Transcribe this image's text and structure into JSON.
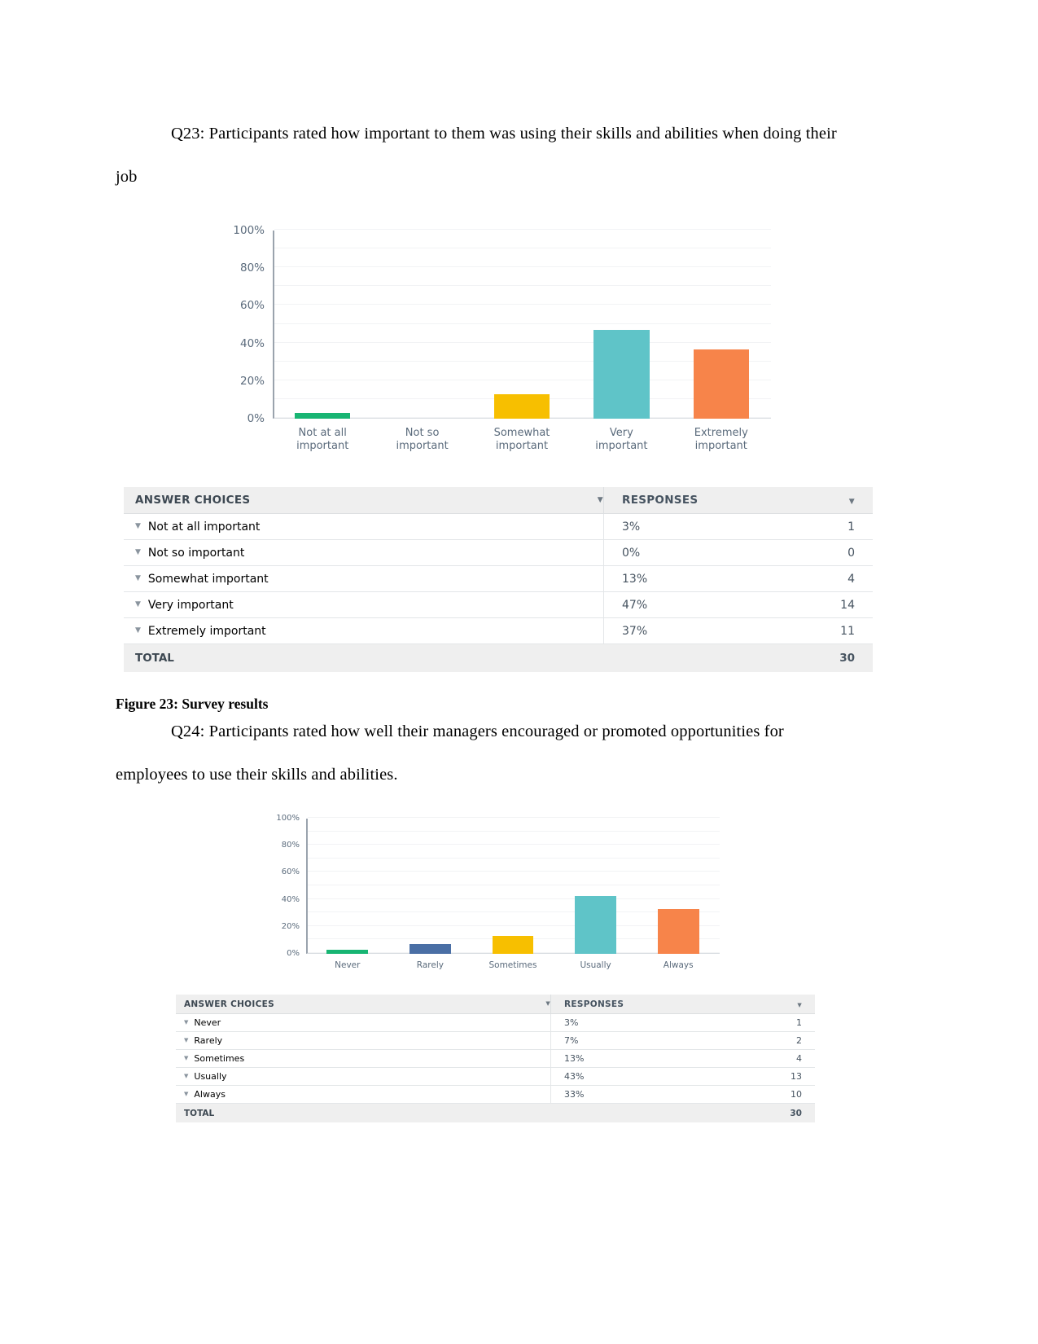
{
  "document": {
    "q23_paragraph": "Q23: Participants rated how important to them was using their skills and abilities when doing their job",
    "figure_caption": "Figure 23: Survey results",
    "q24_paragraph": "Q24: Participants rated how well their managers encouraged or promoted opportunities for employees to use their skills and abilities."
  },
  "survey1": {
    "table": {
      "header": {
        "choices": "ANSWER CHOICES",
        "responses": "RESPONSES",
        "sort_caret": "▼"
      },
      "row_caret": "▼",
      "rows": [
        {
          "label": "Not at all important",
          "percent": "3%",
          "count": "1"
        },
        {
          "label": "Not so important",
          "percent": "0%",
          "count": "0"
        },
        {
          "label": "Somewhat important",
          "percent": "13%",
          "count": "4"
        },
        {
          "label": "Very important",
          "percent": "47%",
          "count": "14"
        },
        {
          "label": "Extremely important",
          "percent": "37%",
          "count": "11"
        }
      ],
      "total_label": "TOTAL",
      "total_count": "30"
    }
  },
  "survey2": {
    "table": {
      "header": {
        "choices": "ANSWER CHOICES",
        "responses": "RESPONSES",
        "sort_caret": "▼"
      },
      "row_caret": "▼",
      "rows": [
        {
          "label": "Never",
          "percent": "3%",
          "count": "1"
        },
        {
          "label": "Rarely",
          "percent": "7%",
          "count": "2"
        },
        {
          "label": "Sometimes",
          "percent": "13%",
          "count": "4"
        },
        {
          "label": "Usually",
          "percent": "43%",
          "count": "13"
        },
        {
          "label": "Always",
          "percent": "33%",
          "count": "10"
        }
      ],
      "total_label": "TOTAL",
      "total_count": "30"
    }
  },
  "chart_data": [
    {
      "type": "bar",
      "title": "",
      "xlabel": "",
      "ylabel": "",
      "ylim": [
        0,
        100
      ],
      "yticks": [
        "0%",
        "20%",
        "40%",
        "60%",
        "80%",
        "100%"
      ],
      "ytick_values": [
        0,
        20,
        40,
        60,
        80,
        100
      ],
      "grid": true,
      "legend": "none",
      "categories": [
        "Not at all important",
        "Not so important",
        "Somewhat important",
        "Very important",
        "Extremely important"
      ],
      "category_lines": [
        [
          "Not at all",
          "important"
        ],
        [
          "Not so",
          "important"
        ],
        [
          "Somewhat",
          "important"
        ],
        [
          "Very",
          "important"
        ],
        [
          "Extremely",
          "important"
        ]
      ],
      "values": [
        3,
        0,
        13,
        47,
        37
      ],
      "colors": [
        "#18b573",
        "#4a6fa5",
        "#f7bf00",
        "#5fc4c8",
        "#f7844a"
      ]
    },
    {
      "type": "bar",
      "title": "",
      "xlabel": "",
      "ylabel": "",
      "ylim": [
        0,
        100
      ],
      "yticks": [
        "0%",
        "20%",
        "40%",
        "60%",
        "80%",
        "100%"
      ],
      "ytick_values": [
        0,
        20,
        40,
        60,
        80,
        100
      ],
      "grid": true,
      "legend": "none",
      "categories": [
        "Never",
        "Rarely",
        "Sometimes",
        "Usually",
        "Always"
      ],
      "category_lines": [
        [
          "Never"
        ],
        [
          "Rarely"
        ],
        [
          "Sometimes"
        ],
        [
          "Usually"
        ],
        [
          "Always"
        ]
      ],
      "values": [
        3,
        7,
        13,
        43,
        33
      ],
      "colors": [
        "#18b573",
        "#4a6fa5",
        "#f7bf00",
        "#5fc4c8",
        "#f7844a"
      ]
    }
  ]
}
